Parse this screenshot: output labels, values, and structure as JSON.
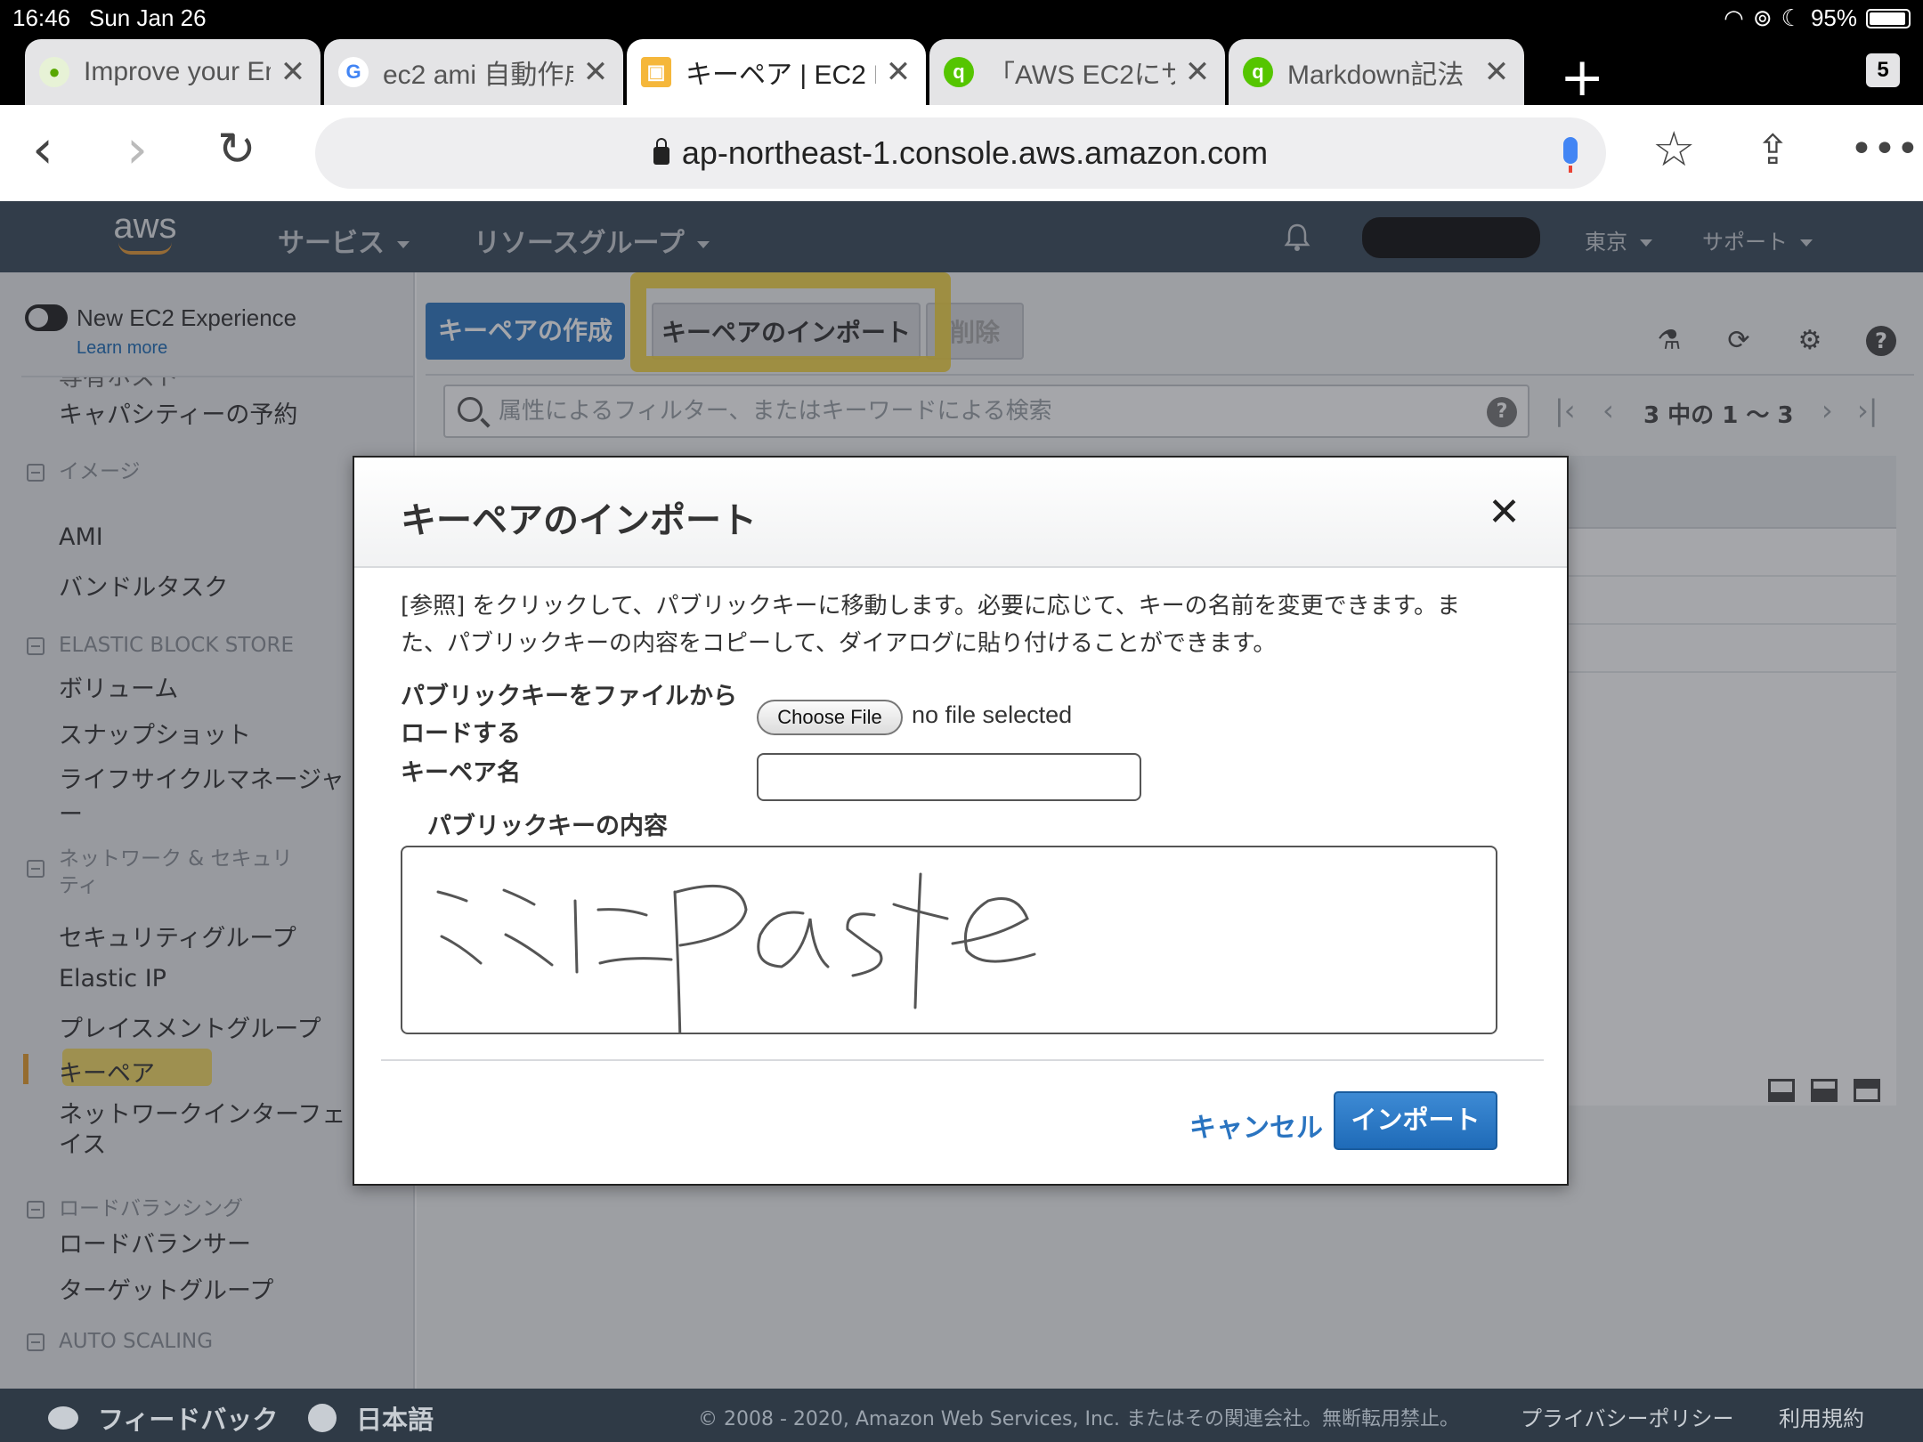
{
  "status_bar": {
    "time": "16:46",
    "date": "Sun Jan 26",
    "battery": "95%"
  },
  "tabs": [
    {
      "label": "Improve your En",
      "favicon": "duolingo-icon",
      "active": false
    },
    {
      "label": "ec2 ami 自動作成",
      "favicon": "google-icon",
      "active": false
    },
    {
      "label": "キーペア | EC2 M",
      "favicon": "aws-box-icon",
      "active": true
    },
    {
      "label": "「AWS EC2にサ",
      "favicon": "qiita-icon",
      "active": false
    },
    {
      "label": "Markdown記法",
      "favicon": "qiita-icon",
      "active": false
    }
  ],
  "tab_count": "5",
  "address": {
    "url": "ap-northeast-1.console.aws.amazon.com"
  },
  "aws_header": {
    "logo": "aws",
    "services": "サービス",
    "resource_groups": "リソースグループ",
    "region": "東京",
    "support": "サポート"
  },
  "sidebar": {
    "new_experience": "New EC2 Experience",
    "learn_more": "Learn more",
    "partial_item": "専有ホスト",
    "capacity_reservation": "キャパシティーの予約",
    "section_images": "イメージ",
    "ami": "AMI",
    "bundle_tasks": "バンドルタスク",
    "section_ebs": "ELASTIC BLOCK STORE",
    "volumes": "ボリューム",
    "snapshots": "スナップショット",
    "lifecycle_manager_1": "ライフサイクルマネージャ",
    "lifecycle_manager_2": "ー",
    "section_network_1": "ネットワーク & セキュリ",
    "section_network_2": "ティ",
    "security_groups": "セキュリティグループ",
    "elastic_ip": "Elastic IP",
    "placement_groups": "プレイスメントグループ",
    "key_pairs": "キーペア",
    "network_interfaces_1": "ネットワークインターフェ",
    "network_interfaces_2": "イス",
    "section_lb": "ロードバランシング",
    "load_balancers": "ロードバランサー",
    "target_groups": "ターゲットグループ",
    "section_autoscaling": "AUTO SCALING"
  },
  "main": {
    "create_key_pair": "キーペアの作成",
    "import_key_pair": "キーペアのインポート",
    "delete": "削除",
    "filter_placeholder": "属性によるフィルター、またはキーワードによる検索",
    "page_info": "3 中の 1 〜 3"
  },
  "modal": {
    "title": "キーペアのインポート",
    "description": "[参照] をクリックして、パブリックキーに移動します。必要に応じて、キーの名前を変更できます。また、パブリックキーの内容をコピーして、ダイアログに貼り付けることができます。",
    "load_label_1": "パブリックキーをファイルから",
    "load_label_2": "ロードする",
    "choose_file": "Choose File",
    "no_file": "no file selected",
    "key_name_label": "キーペア名",
    "key_name_value": "",
    "public_key_label": "パブリックキーの内容",
    "handwritten_note": "ここにPaste",
    "cancel": "キャンセル",
    "import": "インポート"
  },
  "footer": {
    "feedback": "フィードバック",
    "language": "日本語",
    "copyright": "© 2008 - 2020, Amazon Web Services, Inc. またはその関連会社。無断転用禁止。",
    "privacy": "プライバシーポリシー",
    "terms": "利用規約"
  },
  "colors": {
    "aws_header_bg": "#3a4a5a",
    "primary_button": "#2f78c0",
    "annotation_yellow": "#f3d33a",
    "link_blue": "#2a74c0"
  }
}
